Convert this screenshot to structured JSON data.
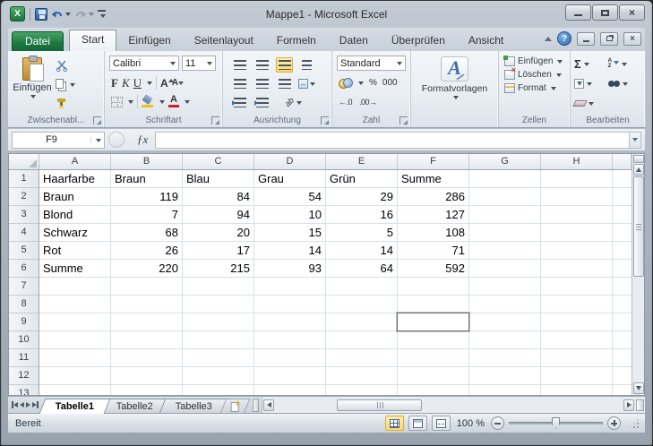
{
  "window": {
    "title": "Mappe1 - Microsoft Excel"
  },
  "ribbon": {
    "file_tab": "Datei",
    "tabs": [
      "Start",
      "Einfügen",
      "Seitenlayout",
      "Formeln",
      "Daten",
      "Überprüfen",
      "Ansicht"
    ],
    "groups": {
      "clipboard": {
        "label": "Zwischenabl...",
        "paste": "Einfügen"
      },
      "font": {
        "label": "Schriftart",
        "family": "Calibri",
        "size": "11",
        "bold": "F",
        "italic": "K",
        "underline": "U"
      },
      "alignment": {
        "label": "Ausrichtung",
        "orientation": "ab"
      },
      "number": {
        "label": "Zahl",
        "format": "Standard",
        "percent": "%",
        "thousands": "000",
        "inc_decimal": "←.0",
        "dec_decimal": ".00→"
      },
      "styles": {
        "button": "Formatvorlagen",
        "icon_letter": "A"
      },
      "cells": {
        "label": "Zellen",
        "insert": "Einfügen",
        "delete": "Löschen",
        "format": "Format"
      },
      "editing": {
        "label": "Bearbeiten",
        "autosum": "Σ",
        "sort_a": "A",
        "sort_z": "Z"
      }
    }
  },
  "formula_bar": {
    "cell_ref": "F9",
    "fx_label": "ƒx"
  },
  "grid": {
    "selected_cell": "F9",
    "column_headers": [
      "A",
      "B",
      "C",
      "D",
      "E",
      "F",
      "G",
      "H"
    ],
    "row_headers": [
      "1",
      "2",
      "3",
      "4",
      "5",
      "6",
      "7",
      "8",
      "9",
      "10",
      "11",
      "12",
      "13"
    ],
    "rows": [
      [
        "Haarfarbe",
        "Braun",
        "Blau",
        "Grau",
        "Grün",
        "Summe"
      ],
      [
        "Braun",
        "119",
        "84",
        "54",
        "29",
        "286"
      ],
      [
        "Blond",
        "7",
        "94",
        "10",
        "16",
        "127"
      ],
      [
        "Schwarz",
        "68",
        "20",
        "15",
        "5",
        "108"
      ],
      [
        "Rot",
        "26",
        "17",
        "14",
        "14",
        "71"
      ],
      [
        "Summe",
        "220",
        "215",
        "93",
        "64",
        "592"
      ]
    ]
  },
  "sheet_tabs": {
    "active": "Tabelle1",
    "tabs": [
      "Tabelle1",
      "Tabelle2",
      "Tabelle3"
    ]
  },
  "status_bar": {
    "mode": "Bereit",
    "zoom_level": "100 %"
  },
  "colors": {
    "file_tab_green": "#1e7a43",
    "highlight_yellow": "#fbd96e",
    "selection_border": "#6b6b6b"
  }
}
